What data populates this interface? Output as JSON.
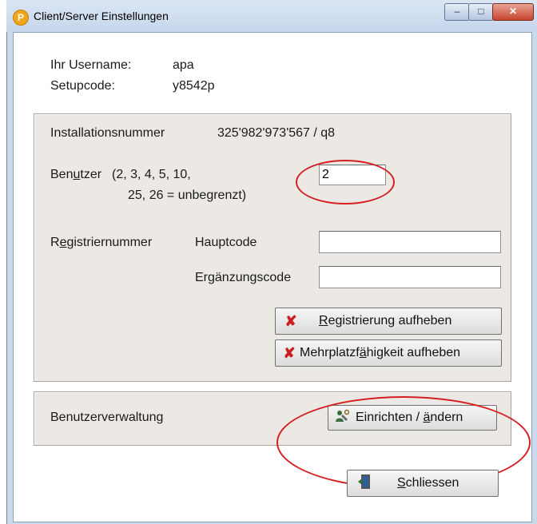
{
  "window": {
    "title": "Client/Server Einstellungen",
    "app_icon": "P",
    "caption_minimize": "–",
    "caption_maximize": "□",
    "caption_close": "✕"
  },
  "user_info": {
    "username_label": "Ihr Username:",
    "username_value": "apa",
    "setupcode_label": "Setupcode:",
    "setupcode_value": "y8542p"
  },
  "license": {
    "installation_label": "Installationsnummer",
    "installation_value": "325'982'973'567 / q8",
    "users_label_pre": "Ben",
    "users_label_u": "u",
    "users_label_post": "tzer",
    "users_hint_line1": "(2, 3, 4, 5, 10,",
    "users_hint_line2": "25, 26 = unbegrenzt)",
    "users_value": "2",
    "reg_label_pre": "R",
    "reg_label_u": "e",
    "reg_label_post": "gistriernummer",
    "main_code_label": "Hauptcode",
    "main_code_value": "",
    "extra_code_label": "Ergänzungscode",
    "extra_code_value": "",
    "cancel_registration": {
      "u": "R",
      "rest": "egistrierung aufheben"
    },
    "cancel_multiuser": {
      "pre": "Mehrplatzf",
      "u": "ä",
      "post": "higkeit aufheben"
    }
  },
  "users_admin": {
    "label": "Benutzerverwaltung",
    "setup_button": {
      "pre": "Einrichten / ",
      "u": "ä",
      "post": "ndern"
    }
  },
  "close_button": {
    "u": "S",
    "rest": "chliessen"
  },
  "icons": {
    "cancel_registration": "red-x-icon",
    "cancel_multiuser": "red-x-icon",
    "setup": "user-tools-icon",
    "close": "exit-door-icon"
  },
  "colors": {
    "annotation": "#d42020",
    "group_bg": "#ece9e4",
    "frame": "#c9d9ec"
  }
}
